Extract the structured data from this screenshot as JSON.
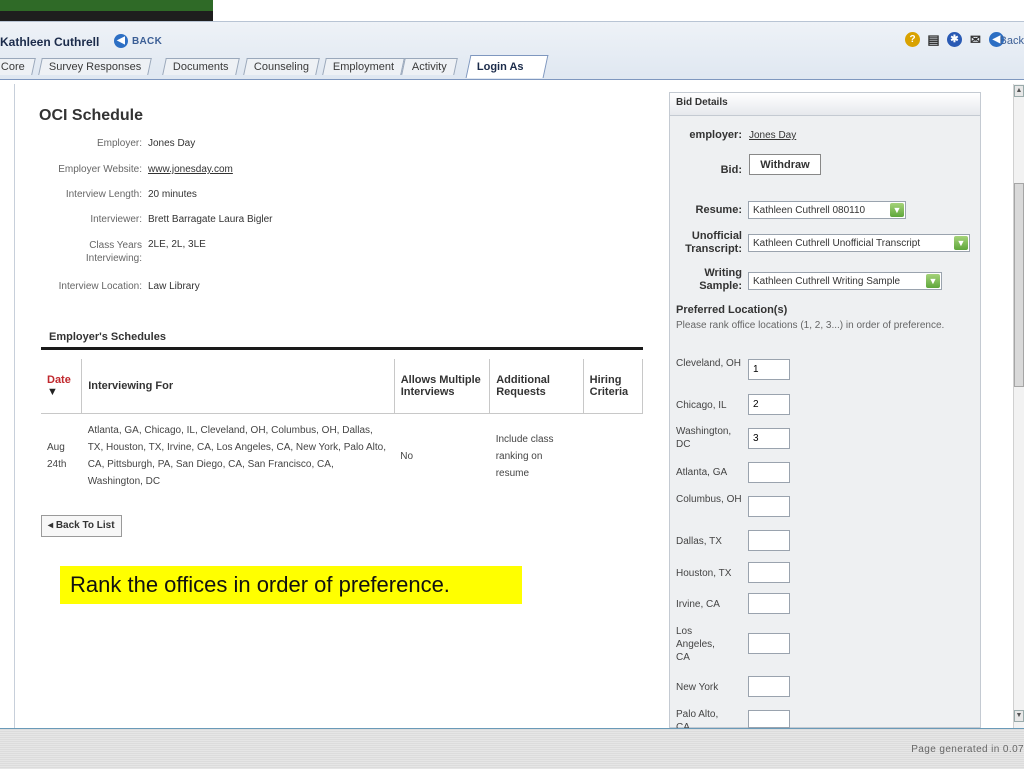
{
  "header": {
    "student_name": "Kathleen Cuthrell",
    "back_label": "BACK",
    "back_top_label": "Back"
  },
  "tabs": [
    {
      "label": "Core"
    },
    {
      "label": "Survey Responses"
    },
    {
      "label": "Documents"
    },
    {
      "label": "Counseling"
    },
    {
      "label": "Employment"
    },
    {
      "label": "Activity"
    },
    {
      "label": "Login As",
      "active": true
    }
  ],
  "oci": {
    "title": "OCI Schedule",
    "details": [
      {
        "label": "Employer:",
        "value": "Jones Day"
      },
      {
        "label": "Employer Website:",
        "value": "www.jonesday.com"
      },
      {
        "label": "Interview Length:",
        "value": "20 minutes"
      },
      {
        "label": "Interviewer:",
        "value": "Brett Barragate Laura Bigler"
      },
      {
        "label": "Class Years Interviewing:",
        "value": "2LE, 2L, 3LE"
      },
      {
        "label": "Interview Location:",
        "value": "Law Library"
      }
    ],
    "schedules_heading": "Employer's Schedules",
    "columns": [
      "Date",
      "Interviewing For",
      "Allows Multiple Interviews",
      "Additional Requests",
      "Hiring Criteria"
    ],
    "rows": [
      {
        "date": "Aug 24th",
        "interviewing_for": "Atlanta, GA, Chicago, IL, Cleveland, OH, Columbus, OH, Dallas, TX, Houston, TX, Irvine, CA, Los Angeles, CA, New York, Palo Alto, CA, Pittsburgh, PA, San Diego, CA, San Francisco, CA, Washington, DC",
        "multiple": "No",
        "additional": "Include class ranking on resume",
        "hiring": ""
      }
    ],
    "back_to_list": "Back To List"
  },
  "instruction": "Rank the offices in order of preference.",
  "bid": {
    "header": "Bid Details",
    "employer_label": "employer:",
    "employer_value": "Jones Day",
    "bid_label": "Bid:",
    "withdraw_label": "Withdraw",
    "resume_label": "Resume:",
    "resume_value": "Kathleen Cuthrell 080110",
    "transcript_label": "Unofficial Transcript:",
    "transcript_value": "Kathleen Cuthrell Unofficial Transcript",
    "writing_label": "Writing Sample:",
    "writing_value": "Kathleen Cuthrell Writing Sample",
    "pref_title": "Preferred Location(s)",
    "pref_desc": "Please rank office locations (1, 2, 3...) in order of preference.",
    "locations": [
      {
        "name": "Cleveland, OH",
        "rank": "1"
      },
      {
        "name": "Chicago, IL",
        "rank": "2"
      },
      {
        "name": "Washington, DC",
        "rank": "3"
      },
      {
        "name": "Atlanta, GA",
        "rank": ""
      },
      {
        "name": "Columbus, OH",
        "rank": ""
      },
      {
        "name": "Dallas, TX",
        "rank": ""
      },
      {
        "name": "Houston, TX",
        "rank": ""
      },
      {
        "name": "Irvine, CA",
        "rank": ""
      },
      {
        "name": "Los Angeles, CA",
        "rank": ""
      },
      {
        "name": "New York",
        "rank": ""
      },
      {
        "name": "Palo Alto, CA",
        "rank": ""
      }
    ]
  },
  "footer": {
    "page_generated": "Page generated in 0.07"
  },
  "colors": {
    "brand_green": "#2f6a27",
    "date_header_red": "#c0282d",
    "highlight_yellow": "#ffff00",
    "link_blue": "#3b5e95"
  }
}
